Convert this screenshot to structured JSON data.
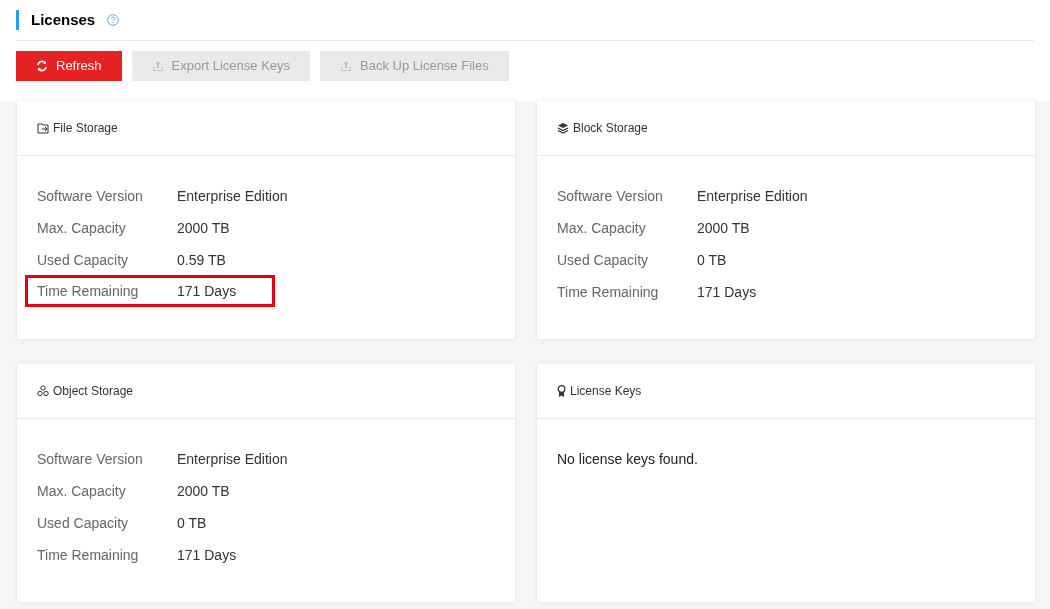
{
  "title": "Licenses",
  "buttons": [
    {
      "label": "Refresh",
      "disabled": false
    },
    {
      "label": "Export License Keys",
      "disabled": true
    },
    {
      "label": "Back Up License Files",
      "disabled": true
    }
  ],
  "cards": [
    {
      "kind": "details",
      "title": "File Storage",
      "rows": [
        {
          "label": "Software Version",
          "value": "Enterprise Edition",
          "highlighted": false
        },
        {
          "label": "Max. Capacity",
          "value": "2000 TB",
          "highlighted": false
        },
        {
          "label": "Used Capacity",
          "value": "0.59 TB",
          "highlighted": false
        },
        {
          "label": "Time Remaining",
          "value": "171 Days",
          "highlighted": true
        }
      ]
    },
    {
      "kind": "details",
      "title": "Block Storage",
      "rows": [
        {
          "label": "Software Version",
          "value": "Enterprise Edition",
          "highlighted": false
        },
        {
          "label": "Max. Capacity",
          "value": "2000 TB",
          "highlighted": false
        },
        {
          "label": "Used Capacity",
          "value": "0 TB",
          "highlighted": false
        },
        {
          "label": "Time Remaining",
          "value": "171 Days",
          "highlighted": false
        }
      ]
    },
    {
      "kind": "details",
      "title": "Object Storage",
      "rows": [
        {
          "label": "Software Version",
          "value": "Enterprise Edition",
          "highlighted": false
        },
        {
          "label": "Max. Capacity",
          "value": "2000 TB",
          "highlighted": false
        },
        {
          "label": "Used Capacity",
          "value": "0 TB",
          "highlighted": false
        },
        {
          "label": "Time Remaining",
          "value": "171 Days",
          "highlighted": false
        }
      ]
    },
    {
      "kind": "message",
      "title": "License Keys",
      "message": "No license keys found."
    }
  ]
}
